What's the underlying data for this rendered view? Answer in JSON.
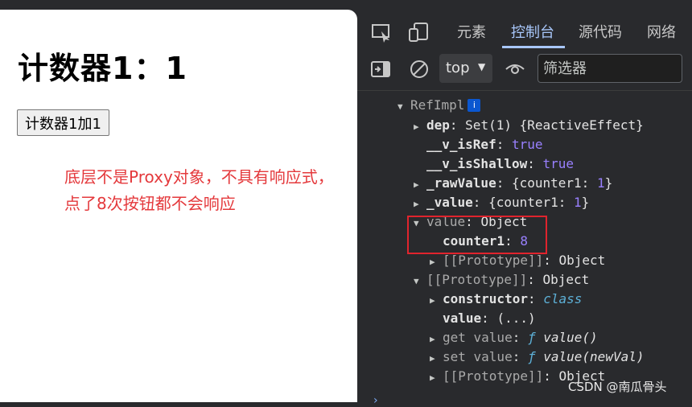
{
  "page": {
    "title": "计数器1：1",
    "button_label": "计数器1加1",
    "note": "底层不是Proxy对象，不具有响应式，点了8次按钮都不会响应"
  },
  "devtools": {
    "tabs": [
      "元素",
      "控制台",
      "源代码",
      "网络"
    ],
    "active_tab": "控制台",
    "context": "top",
    "filter_placeholder": "筛选器",
    "colors": {
      "accent": "#a8c7fa",
      "highlight": "#e0242d",
      "number": "#9980ff"
    },
    "icons": [
      "inspect-icon",
      "device-toggle-icon",
      "sidebar-toggle-icon",
      "clear-console-icon",
      "dropdown-caret-icon",
      "eye-icon"
    ],
    "console_rows": {
      "r0": {
        "name": "RefImpl",
        "badge": "i"
      },
      "r1": {
        "key": "dep",
        "value": "Set(1) {ReactiveEffect}"
      },
      "r2": {
        "key": "__v_isRef",
        "value": "true"
      },
      "r3": {
        "key": "__v_isShallow",
        "value": "true"
      },
      "r4": {
        "key": "_rawValue",
        "pre": "{counter1: ",
        "num": "1",
        "post": "}"
      },
      "r5": {
        "key": "_value",
        "pre": "{counter1: ",
        "num": "1",
        "post": "}"
      },
      "r6": {
        "key": "value",
        "value": "Object"
      },
      "r7": {
        "key": "counter1",
        "num": "8"
      },
      "r8": {
        "key": "[[Prototype]]",
        "value": "Object"
      },
      "r9": {
        "key": "[[Prototype]]",
        "value": "Object"
      },
      "r10": {
        "key": "constructor",
        "value": "class"
      },
      "r11": {
        "key": "value",
        "value": "(...)"
      },
      "r12": {
        "key": "get value",
        "f": "ƒ",
        "fn": "value()"
      },
      "r13": {
        "key": "set value",
        "f": "ƒ",
        "fn": "value(newVal)"
      },
      "r14": {
        "key": "[[Prototype]]",
        "value": "Object"
      }
    },
    "separator": ": ",
    "expanded": "▼",
    "collapsed": "▶"
  },
  "watermark": "CSDN @南瓜骨头"
}
